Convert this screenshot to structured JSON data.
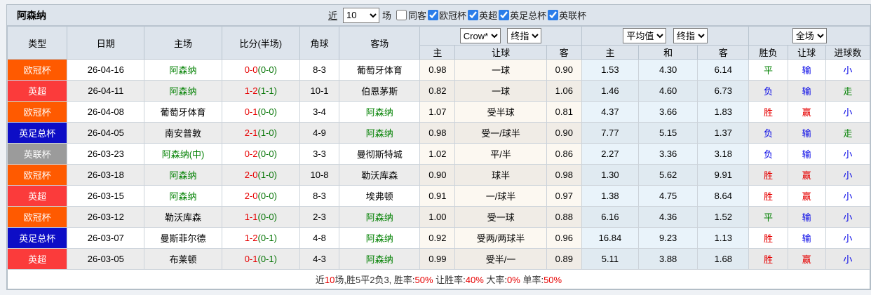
{
  "colors": {
    "header_bg": "#dde4ec",
    "checkbox_accent": "#2b7de9",
    "badge_ucl": "#ff5a00",
    "badge_epl": "#fb3b3b",
    "badge_fa_cup": "#0d0dc6",
    "badge_league_cup": "#9b9b9b",
    "team_highlight": "#008000",
    "score_fulltime": "#e60000",
    "score_halftime": "#067506",
    "win": "#e60000",
    "draw_green": "#008000",
    "loss_blue": "#0000e6",
    "crow_col_bg": "#fcf8f1",
    "avg_col_bg": "#e9f3fa"
  },
  "topbar": {
    "title": "阿森纳",
    "recent_label": "近",
    "recent_value": "10",
    "matches_label": "场",
    "same_away": {
      "label": "同客",
      "checked": false
    },
    "filters": [
      {
        "key": "ucl",
        "label": "欧冠杯",
        "checked": true
      },
      {
        "key": "epl",
        "label": "英超",
        "checked": true
      },
      {
        "key": "fa-cup",
        "label": "英足总杯",
        "checked": true
      },
      {
        "key": "league-cup",
        "label": "英联杯",
        "checked": true
      }
    ]
  },
  "table": {
    "main_columns": [
      "类型",
      "日期",
      "主场",
      "比分(半场)",
      "角球",
      "客场"
    ],
    "selectors": {
      "company": "Crow*",
      "company_stage": "终指",
      "average": "平均值",
      "average_stage": "终指",
      "scope": "全场"
    },
    "sub_columns": [
      "主",
      "让球",
      "客",
      "主",
      "和",
      "客",
      "胜负",
      "让球",
      "进球数"
    ],
    "rows": [
      {
        "type": {
          "label": "欧冠杯",
          "key": "ucl"
        },
        "date": "26-04-16",
        "home": {
          "name": "阿森纳",
          "color": "green"
        },
        "score": {
          "ft": "0-0",
          "ht": "(0-0)"
        },
        "corners": "8-3",
        "away": {
          "name": "葡萄牙体育",
          "color": "black"
        },
        "crow": {
          "home": "0.98",
          "handicap": "一球",
          "away": "0.90"
        },
        "avg": {
          "home": "1.53",
          "draw": "4.30",
          "away": "6.14"
        },
        "result": {
          "text": "平",
          "color": "green"
        },
        "handicap_result": {
          "text": "输",
          "color": "blue"
        },
        "goals": {
          "text": "小",
          "color": "blue"
        }
      },
      {
        "type": {
          "label": "英超",
          "key": "epl"
        },
        "date": "26-04-11",
        "home": {
          "name": "阿森纳",
          "color": "green"
        },
        "score": {
          "ft": "1-2",
          "ht": "(1-1)"
        },
        "corners": "10-1",
        "away": {
          "name": "伯恩茅斯",
          "color": "black"
        },
        "crow": {
          "home": "0.82",
          "handicap": "一球",
          "away": "1.06"
        },
        "avg": {
          "home": "1.46",
          "draw": "4.60",
          "away": "6.73"
        },
        "result": {
          "text": "负",
          "color": "blue"
        },
        "handicap_result": {
          "text": "输",
          "color": "blue"
        },
        "goals": {
          "text": "走",
          "color": "green"
        }
      },
      {
        "type": {
          "label": "欧冠杯",
          "key": "ucl"
        },
        "date": "26-04-08",
        "home": {
          "name": "葡萄牙体育",
          "color": "black"
        },
        "score": {
          "ft": "0-1",
          "ht": "(0-0)"
        },
        "corners": "3-4",
        "away": {
          "name": "阿森纳",
          "color": "green"
        },
        "crow": {
          "home": "1.07",
          "handicap": "受半球",
          "away": "0.81"
        },
        "avg": {
          "home": "4.37",
          "draw": "3.66",
          "away": "1.83"
        },
        "result": {
          "text": "胜",
          "color": "red"
        },
        "handicap_result": {
          "text": "赢",
          "color": "red"
        },
        "goals": {
          "text": "小",
          "color": "blue"
        }
      },
      {
        "type": {
          "label": "英足总杯",
          "key": "fa"
        },
        "date": "26-04-05",
        "home": {
          "name": "南安普敦",
          "color": "black"
        },
        "score": {
          "ft": "2-1",
          "ht": "(1-0)"
        },
        "corners": "4-9",
        "away": {
          "name": "阿森纳",
          "color": "green"
        },
        "crow": {
          "home": "0.98",
          "handicap": "受一/球半",
          "away": "0.90"
        },
        "avg": {
          "home": "7.77",
          "draw": "5.15",
          "away": "1.37"
        },
        "result": {
          "text": "负",
          "color": "blue"
        },
        "handicap_result": {
          "text": "输",
          "color": "blue"
        },
        "goals": {
          "text": "走",
          "color": "green"
        }
      },
      {
        "type": {
          "label": "英联杯",
          "key": "lc"
        },
        "date": "26-03-23",
        "home": {
          "name": "阿森纳(中)",
          "color": "green"
        },
        "score": {
          "ft": "0-2",
          "ht": "(0-0)"
        },
        "corners": "3-3",
        "away": {
          "name": "曼彻斯特城",
          "color": "black"
        },
        "crow": {
          "home": "1.02",
          "handicap": "平/半",
          "away": "0.86"
        },
        "avg": {
          "home": "2.27",
          "draw": "3.36",
          "away": "3.18"
        },
        "result": {
          "text": "负",
          "color": "blue"
        },
        "handicap_result": {
          "text": "输",
          "color": "blue"
        },
        "goals": {
          "text": "小",
          "color": "blue"
        }
      },
      {
        "type": {
          "label": "欧冠杯",
          "key": "ucl"
        },
        "date": "26-03-18",
        "home": {
          "name": "阿森纳",
          "color": "green"
        },
        "score": {
          "ft": "2-0",
          "ht": "(1-0)"
        },
        "corners": "10-8",
        "away": {
          "name": "勒沃库森",
          "color": "black"
        },
        "crow": {
          "home": "0.90",
          "handicap": "球半",
          "away": "0.98"
        },
        "avg": {
          "home": "1.30",
          "draw": "5.62",
          "away": "9.91"
        },
        "result": {
          "text": "胜",
          "color": "red"
        },
        "handicap_result": {
          "text": "赢",
          "color": "red"
        },
        "goals": {
          "text": "小",
          "color": "blue"
        }
      },
      {
        "type": {
          "label": "英超",
          "key": "epl"
        },
        "date": "26-03-15",
        "home": {
          "name": "阿森纳",
          "color": "green"
        },
        "score": {
          "ft": "2-0",
          "ht": "(0-0)"
        },
        "corners": "8-3",
        "away": {
          "name": "埃弗顿",
          "color": "black"
        },
        "crow": {
          "home": "0.91",
          "handicap": "一/球半",
          "away": "0.97"
        },
        "avg": {
          "home": "1.38",
          "draw": "4.75",
          "away": "8.64"
        },
        "result": {
          "text": "胜",
          "color": "red"
        },
        "handicap_result": {
          "text": "赢",
          "color": "red"
        },
        "goals": {
          "text": "小",
          "color": "blue"
        }
      },
      {
        "type": {
          "label": "欧冠杯",
          "key": "ucl"
        },
        "date": "26-03-12",
        "home": {
          "name": "勒沃库森",
          "color": "black"
        },
        "score": {
          "ft": "1-1",
          "ht": "(0-0)"
        },
        "corners": "2-3",
        "away": {
          "name": "阿森纳",
          "color": "green"
        },
        "crow": {
          "home": "1.00",
          "handicap": "受一球",
          "away": "0.88"
        },
        "avg": {
          "home": "6.16",
          "draw": "4.36",
          "away": "1.52"
        },
        "result": {
          "text": "平",
          "color": "green"
        },
        "handicap_result": {
          "text": "输",
          "color": "blue"
        },
        "goals": {
          "text": "小",
          "color": "blue"
        }
      },
      {
        "type": {
          "label": "英足总杯",
          "key": "fa"
        },
        "date": "26-03-07",
        "home": {
          "name": "曼斯菲尔德",
          "color": "black"
        },
        "score": {
          "ft": "1-2",
          "ht": "(0-1)"
        },
        "corners": "4-8",
        "away": {
          "name": "阿森纳",
          "color": "green"
        },
        "crow": {
          "home": "0.92",
          "handicap": "受两/两球半",
          "away": "0.96"
        },
        "avg": {
          "home": "16.84",
          "draw": "9.23",
          "away": "1.13"
        },
        "result": {
          "text": "胜",
          "color": "red"
        },
        "handicap_result": {
          "text": "输",
          "color": "blue"
        },
        "goals": {
          "text": "小",
          "color": "blue"
        }
      },
      {
        "type": {
          "label": "英超",
          "key": "epl"
        },
        "date": "26-03-05",
        "home": {
          "name": "布莱顿",
          "color": "black"
        },
        "score": {
          "ft": "0-1",
          "ht": "(0-1)"
        },
        "corners": "4-3",
        "away": {
          "name": "阿森纳",
          "color": "green"
        },
        "crow": {
          "home": "0.99",
          "handicap": "受半/一",
          "away": "0.89"
        },
        "avg": {
          "home": "5.11",
          "draw": "3.88",
          "away": "1.68"
        },
        "result": {
          "text": "胜",
          "color": "red"
        },
        "handicap_result": {
          "text": "赢",
          "color": "red"
        },
        "goals": {
          "text": "小",
          "color": "blue"
        }
      }
    ]
  },
  "footer": {
    "segments": [
      {
        "text": "近",
        "color": "dark"
      },
      {
        "text": "10",
        "color": "red"
      },
      {
        "text": "场,胜5平2负3, 胜率:",
        "color": "dark"
      },
      {
        "text": "50%",
        "color": "red"
      },
      {
        "text": " 让胜率:",
        "color": "dark"
      },
      {
        "text": "40%",
        "color": "red"
      },
      {
        "text": " 大率:",
        "color": "dark"
      },
      {
        "text": "0%",
        "color": "red"
      },
      {
        "text": " 单率:",
        "color": "dark"
      },
      {
        "text": "50%",
        "color": "red"
      }
    ]
  }
}
